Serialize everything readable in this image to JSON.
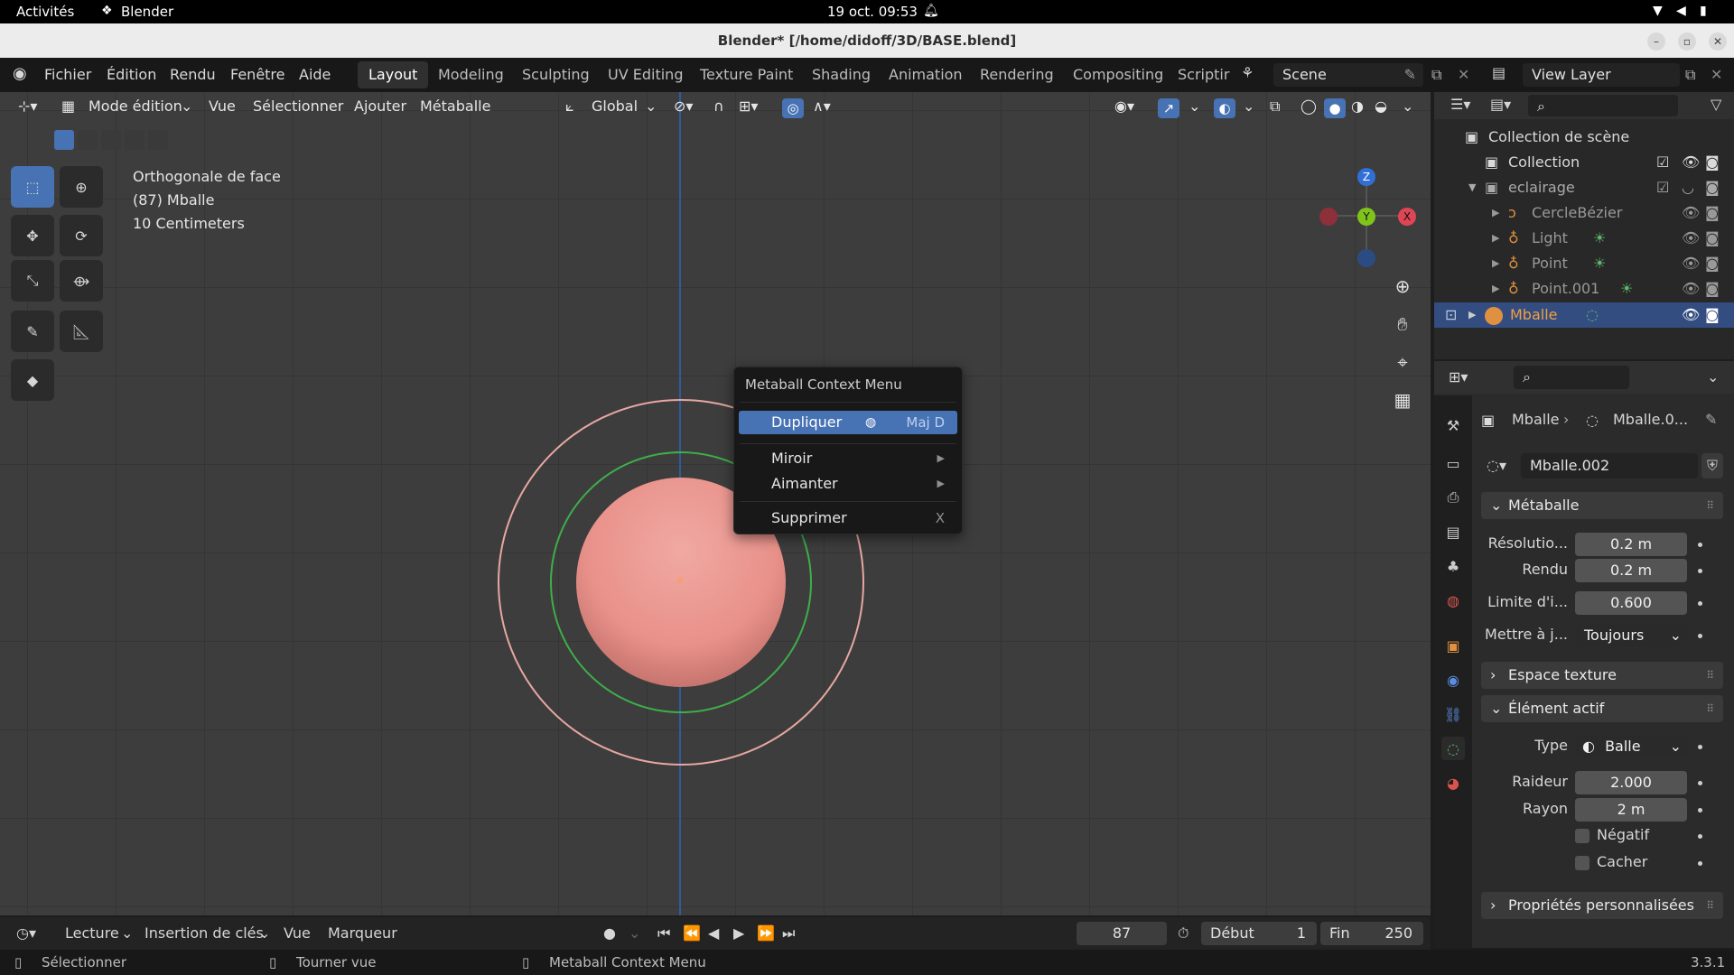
{
  "gnome": {
    "activities": "Activités",
    "app": "Blender",
    "datetime": "19 oct.  09:53"
  },
  "window": {
    "title": "Blender* [/home/didoff/3D/BASE.blend]"
  },
  "menu": {
    "file": "Fichier",
    "edit": "Édition",
    "render": "Rendu",
    "window": "Fenêtre",
    "help": "Aide"
  },
  "workspaces": [
    "Layout",
    "Modeling",
    "Sculpting",
    "UV Editing",
    "Texture Paint",
    "Shading",
    "Animation",
    "Rendering",
    "Compositing",
    "Scriptir"
  ],
  "scene": {
    "name": "Scene",
    "view_layer": "View Layer"
  },
  "viewport_header": {
    "mode": "Mode édition",
    "view": "Vue",
    "select": "Sélectionner",
    "add": "Ajouter",
    "metaball": "Métaballe",
    "orientation": "Global"
  },
  "viewport": {
    "view_name": "Orthogonale de face",
    "object_info": "(87) Mballe",
    "scale": "10 Centimeters"
  },
  "gizmo": {
    "z": "Z",
    "y": "Y",
    "x": "X"
  },
  "context_menu": {
    "title": "Metaball Context Menu",
    "duplicate": "Dupliquer",
    "duplicate_key": "Maj D",
    "mirror": "Miroir",
    "snap": "Aimanter",
    "delete": "Supprimer",
    "delete_key": "X"
  },
  "outliner": {
    "scene_collection": "Collection de scène",
    "items": [
      {
        "label": "Collection"
      },
      {
        "label": "eclairage"
      },
      {
        "label": "CercleBézier"
      },
      {
        "label": "Light"
      },
      {
        "label": "Point"
      },
      {
        "label": "Point.001"
      },
      {
        "label": "Mballe"
      }
    ]
  },
  "properties": {
    "breadcrumb_object": "Mballe",
    "breadcrumb_data": "Mballe.0...",
    "datablock": "Mballe.002",
    "metaball_panel": "Métaballe",
    "resolution_label": "Résolutio...",
    "resolution_value": "0.2 m",
    "render_label": "Rendu",
    "render_value": "0.2 m",
    "threshold_label": "Limite d'i...",
    "threshold_value": "0.600",
    "update_label": "Mettre à j...",
    "update_value": "Toujours",
    "texture_space_panel": "Espace texture",
    "active_element_panel": "Élément actif",
    "type_label": "Type",
    "type_value": "Balle",
    "stiffness_label": "Raideur",
    "stiffness_value": "2.000",
    "radius_label": "Rayon",
    "radius_value": "2 m",
    "negative_label": "Négatif",
    "hide_label": "Cacher",
    "custom_props_panel": "Propriétés personnalisées"
  },
  "timeline": {
    "playback": "Lecture",
    "keying": "Insertion de clés",
    "view": "Vue",
    "marker": "Marqueur",
    "current_frame": "87",
    "start_label": "Début",
    "start": "1",
    "end_label": "Fin",
    "end": "250"
  },
  "status": {
    "select": "Sélectionner",
    "rotate": "Tourner vue",
    "context": "Metaball Context Menu",
    "version": "3.3.1"
  }
}
